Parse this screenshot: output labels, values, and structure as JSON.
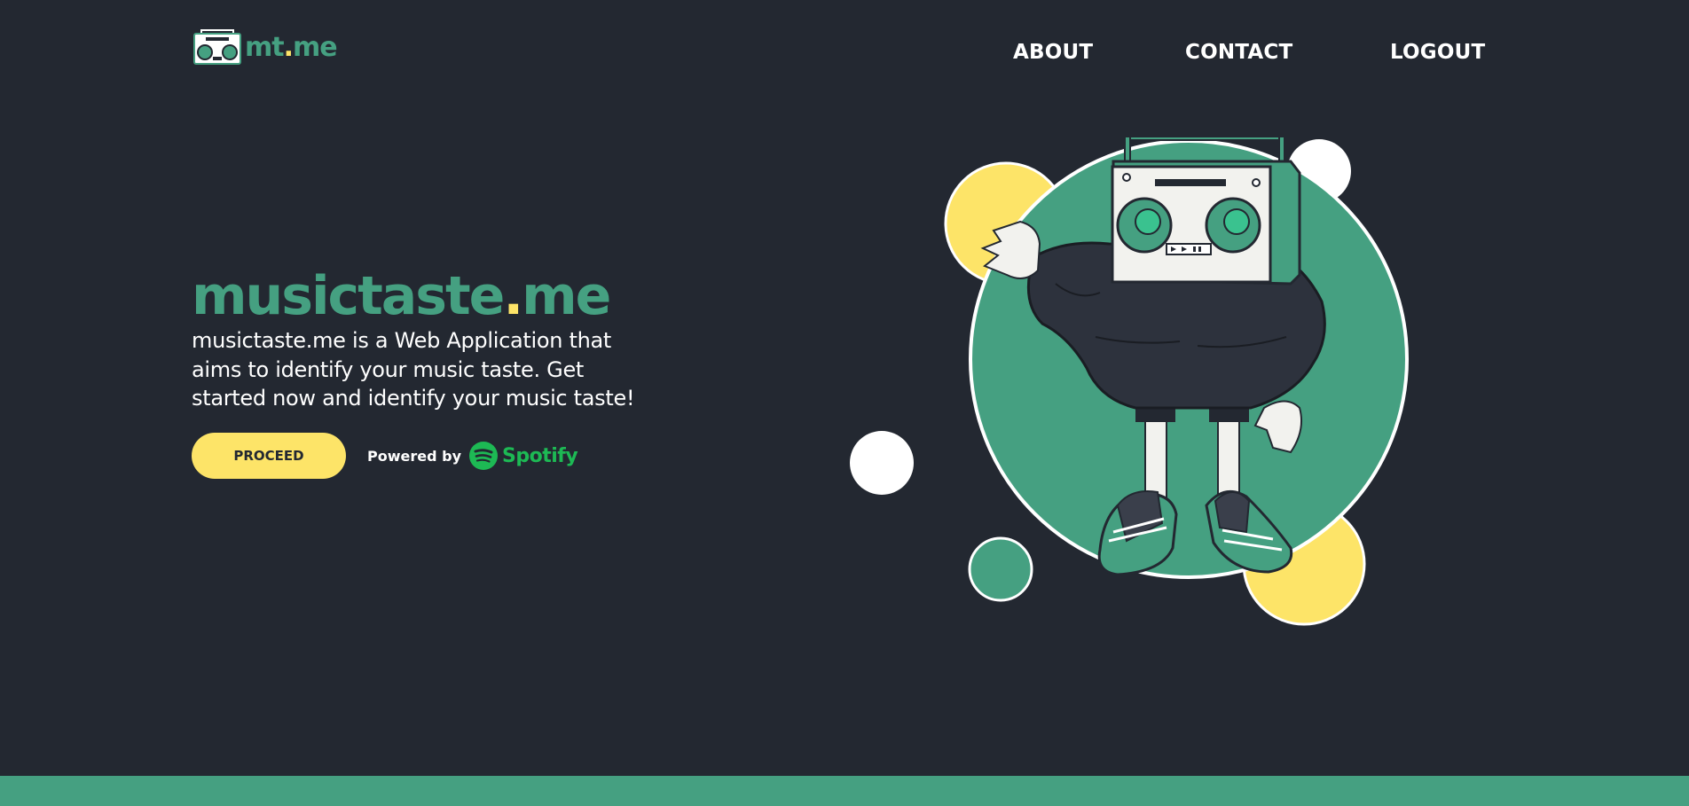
{
  "header": {
    "logo_text_main": "mt",
    "logo_text_dot": ".",
    "logo_text_end": "me",
    "nav": [
      "ABOUT",
      "CONTACT",
      "LOGOUT"
    ]
  },
  "hero": {
    "title_main": "musictaste",
    "title_dot": ".",
    "title_end": "me",
    "description": "musictaste.me is a Web Application that aims to identify your music taste. Get started now and identify your music taste!",
    "proceed_label": "PROCEED",
    "powered_by": "Powered by",
    "spotify": "Spotify",
    "spotify_icon": "spotify-icon"
  },
  "illustration": {
    "icon": "boombox-head-character-illustration"
  },
  "colors": {
    "background": "#232831",
    "green": "#45a081",
    "yellow": "#fde468",
    "white": "#ffffff",
    "spotify_green": "#1db954"
  }
}
